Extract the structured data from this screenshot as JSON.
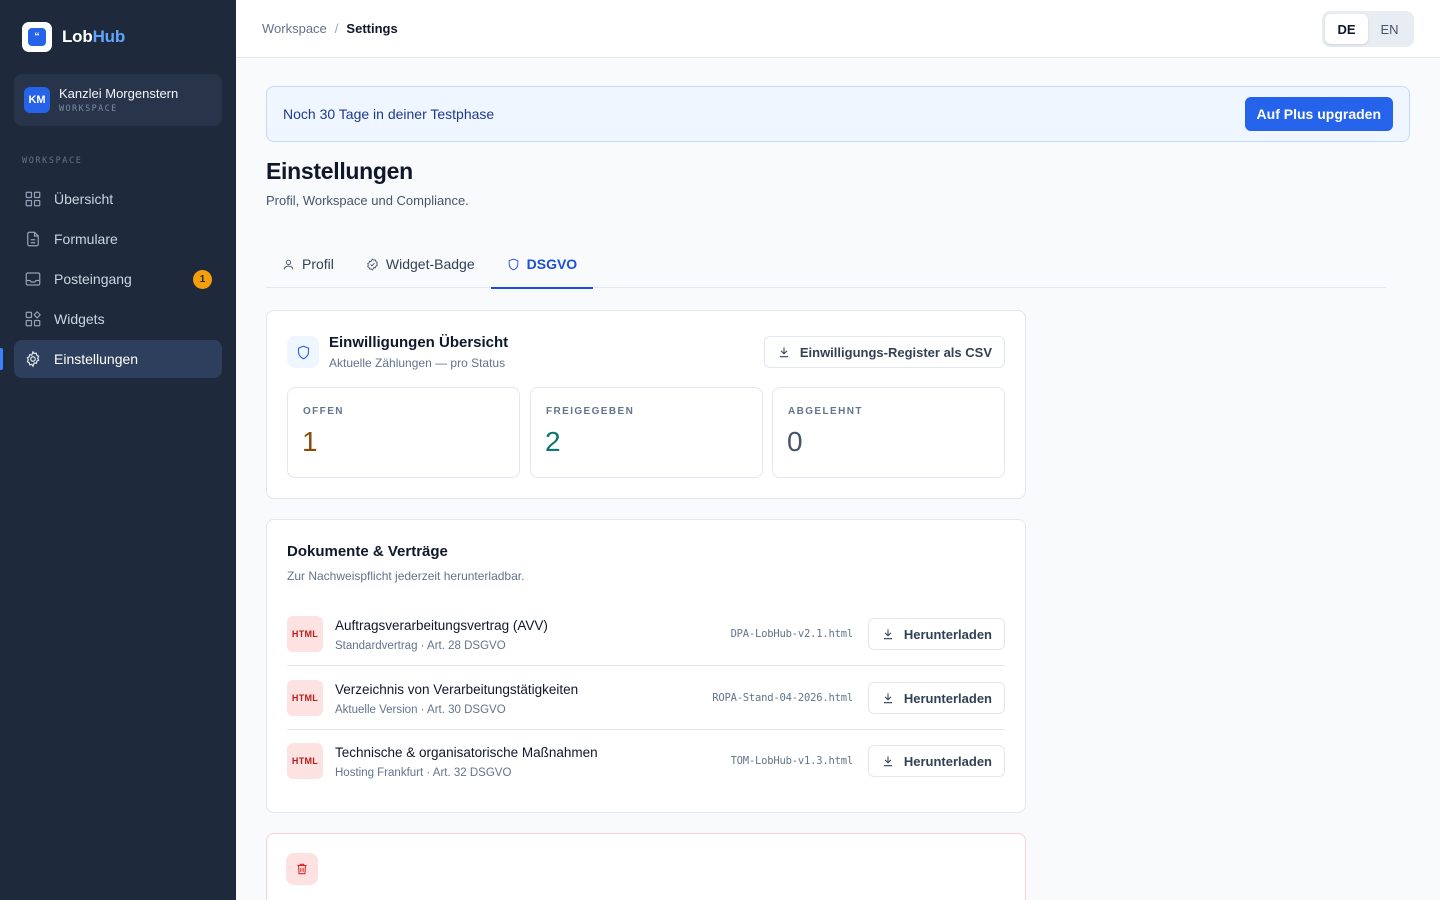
{
  "brand": {
    "name_part1": "Lob",
    "name_part2": "Hub",
    "logo_glyph": "“"
  },
  "workspace": {
    "initials": "KM",
    "name": "Kanzlei Morgenstern",
    "label": "WORKSPACE"
  },
  "sidebar": {
    "section_label": "WORKSPACE",
    "items": [
      {
        "label": "Übersicht",
        "icon": "grid-icon"
      },
      {
        "label": "Formulare",
        "icon": "document-icon"
      },
      {
        "label": "Posteingang",
        "icon": "inbox-icon",
        "badge": "1"
      },
      {
        "label": "Widgets",
        "icon": "widgets-icon"
      },
      {
        "label": "Einstellungen",
        "icon": "gear-icon",
        "active": true
      }
    ]
  },
  "breadcrumb": {
    "parent": "Workspace",
    "separator": "/",
    "current": "Settings"
  },
  "language": {
    "options": [
      "DE",
      "EN"
    ],
    "selected": "DE"
  },
  "trial": {
    "text": "Noch 30 Tage in deiner Testphase",
    "cta": "Auf Plus upgraden"
  },
  "page": {
    "title": "Einstellungen",
    "subtitle": "Profil, Workspace und Compliance."
  },
  "tabs": [
    {
      "label": "Profil",
      "icon": "user-icon"
    },
    {
      "label": "Widget-Badge",
      "icon": "badge-check-icon"
    },
    {
      "label": "DSGVO",
      "icon": "shield-icon",
      "active": true
    }
  ],
  "consent": {
    "title": "Einwilligungen Übersicht",
    "subtitle": "Aktuelle Zählungen — pro Status",
    "export_label": "Einwilligungs-Register als CSV",
    "stats": [
      {
        "label": "OFFEN",
        "value": "1",
        "color": "#854d0e"
      },
      {
        "label": "FREIGEGEBEN",
        "value": "2",
        "color": "#0f766e"
      },
      {
        "label": "ABGELEHNT",
        "value": "0",
        "color": "#475569"
      }
    ]
  },
  "documents": {
    "title": "Dokumente & Verträge",
    "subtitle": "Zur Nachweispflicht jederzeit herunterladbar.",
    "download_label": "Herunterladen",
    "items": [
      {
        "type": "HTML",
        "name": "Auftragsverarbeitungsvertrag (AVV)",
        "meta": "Standardvertrag · Art. 28 DSGVO",
        "file": "DPA-LobHub-v2.1.html"
      },
      {
        "type": "HTML",
        "name": "Verzeichnis von Verarbeitungstätigkeiten",
        "meta": "Aktuelle Version · Art. 30 DSGVO",
        "file": "ROPA-Stand-04-2026.html"
      },
      {
        "type": "HTML",
        "name": "Technische & organisatorische Maßnahmen",
        "meta": "Hosting Frankfurt · Art. 32 DSGVO",
        "file": "TOM-LobHub-v1.3.html"
      }
    ]
  },
  "colors": {
    "sidebar_bg": "#1e293b",
    "accent": "#2563eb",
    "danger": "#dc2626"
  }
}
